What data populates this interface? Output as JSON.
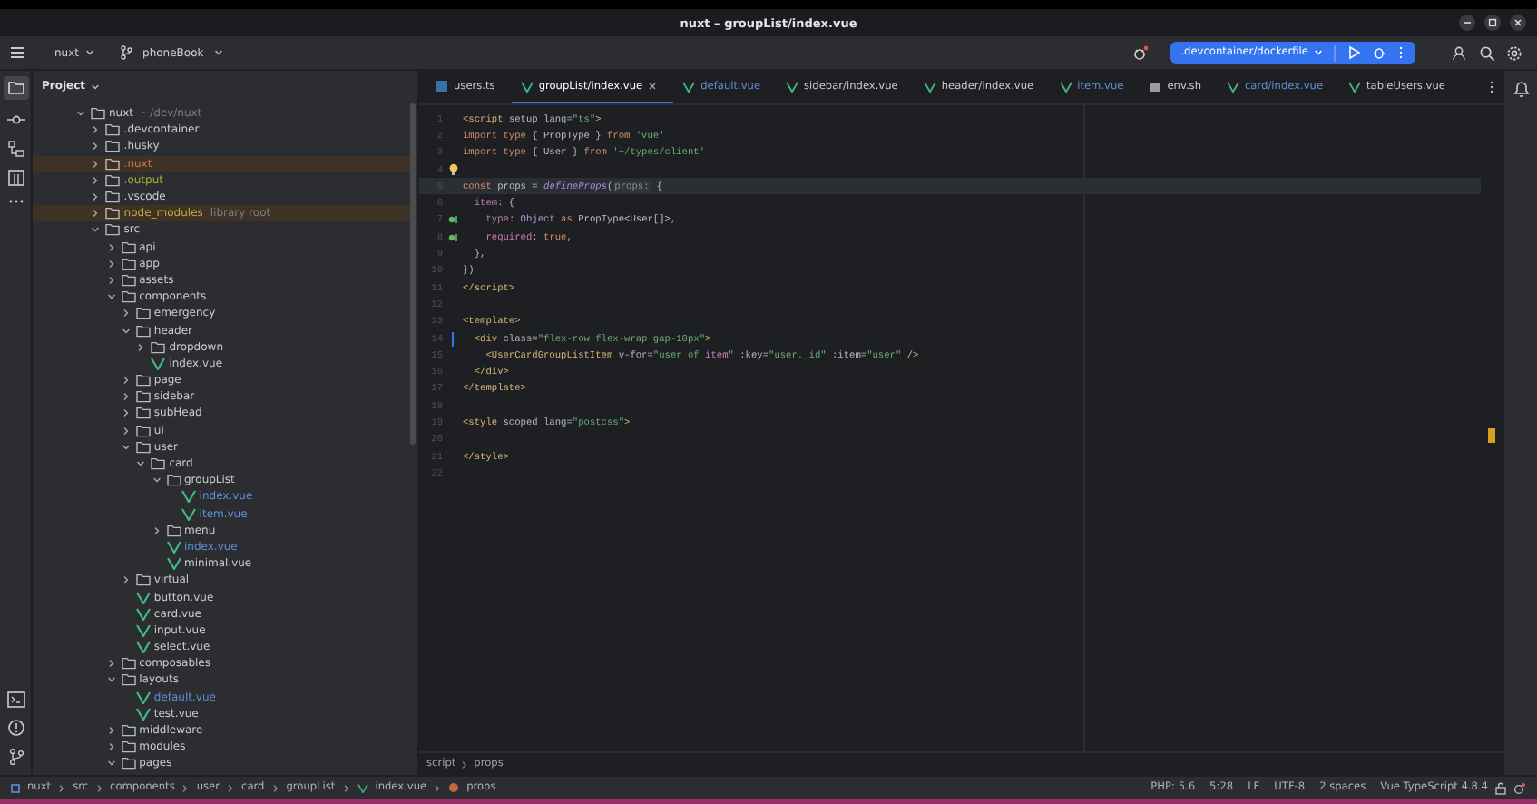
{
  "window": {
    "title": "nuxt – groupList/index.vue"
  },
  "toolbar": {
    "project": "nuxt",
    "branch": "phoneBook",
    "run_config": ".devcontainer/dockerfile"
  },
  "project_panel": {
    "title": "Project",
    "tree": [
      {
        "name": "nuxt",
        "hint": "~/dev/nuxt",
        "kind": "folder",
        "expanded": true,
        "excluded": false,
        "children": [
          {
            "name": ".devcontainer",
            "kind": "folder",
            "expanded": false,
            "excluded": false
          },
          {
            "name": ".husky",
            "kind": "folder",
            "expanded": false,
            "excluded": false
          },
          {
            "name": ".nuxt",
            "kind": "folder",
            "expanded": false,
            "excluded": true,
            "color": "#c2794d"
          },
          {
            "name": ".output",
            "kind": "folder",
            "expanded": false,
            "excluded": false,
            "color": "#a3b13a"
          },
          {
            "name": ".vscode",
            "kind": "folder",
            "expanded": false,
            "excluded": false
          },
          {
            "name": "node_modules",
            "hint": "library root",
            "kind": "folder",
            "expanded": false,
            "excluded": true,
            "color": "#c6a83e"
          },
          {
            "name": "src",
            "kind": "folder",
            "expanded": true,
            "excluded": false,
            "children": [
              {
                "name": "api",
                "kind": "folder",
                "expanded": false,
                "excluded": false
              },
              {
                "name": "app",
                "kind": "folder",
                "expanded": false,
                "excluded": false
              },
              {
                "name": "assets",
                "kind": "folder",
                "expanded": false,
                "excluded": false
              },
              {
                "name": "components",
                "kind": "folder",
                "expanded": true,
                "excluded": false,
                "children": [
                  {
                    "name": "emergency",
                    "kind": "folder",
                    "expanded": false,
                    "excluded": false
                  },
                  {
                    "name": "header",
                    "kind": "folder",
                    "expanded": true,
                    "excluded": false,
                    "children": [
                      {
                        "name": "dropdown",
                        "kind": "folder",
                        "expanded": false,
                        "excluded": false
                      },
                      {
                        "name": "index.vue",
                        "kind": "vue",
                        "excluded": false
                      }
                    ]
                  },
                  {
                    "name": "page",
                    "kind": "folder",
                    "expanded": false,
                    "excluded": false
                  },
                  {
                    "name": "sidebar",
                    "kind": "folder",
                    "expanded": false,
                    "excluded": false
                  },
                  {
                    "name": "subHead",
                    "kind": "folder",
                    "expanded": false,
                    "excluded": false
                  },
                  {
                    "name": "ui",
                    "kind": "folder",
                    "expanded": false,
                    "excluded": false
                  },
                  {
                    "name": "user",
                    "kind": "folder",
                    "expanded": true,
                    "excluded": false,
                    "children": [
                      {
                        "name": "card",
                        "kind": "folder",
                        "expanded": true,
                        "excluded": false,
                        "children": [
                          {
                            "name": "groupList",
                            "kind": "folder",
                            "expanded": true,
                            "excluded": false,
                            "children": [
                              {
                                "name": "index.vue",
                                "kind": "vue",
                                "excluded": false,
                                "color": "#5f8fd6"
                              },
                              {
                                "name": "item.vue",
                                "kind": "vue",
                                "excluded": false,
                                "color": "#5f8fd6"
                              }
                            ]
                          },
                          {
                            "name": "menu",
                            "kind": "folder",
                            "expanded": false,
                            "excluded": false
                          },
                          {
                            "name": "index.vue",
                            "kind": "vue",
                            "excluded": false,
                            "color": "#5f8fd6"
                          },
                          {
                            "name": "minimal.vue",
                            "kind": "vue",
                            "excluded": false
                          }
                        ]
                      }
                    ]
                  },
                  {
                    "name": "virtual",
                    "kind": "folder",
                    "expanded": false,
                    "excluded": false
                  },
                  {
                    "name": "button.vue",
                    "kind": "vue",
                    "excluded": false
                  },
                  {
                    "name": "card.vue",
                    "kind": "vue",
                    "excluded": false
                  },
                  {
                    "name": "input.vue",
                    "kind": "vue",
                    "excluded": false
                  },
                  {
                    "name": "select.vue",
                    "kind": "vue",
                    "excluded": false
                  }
                ]
              },
              {
                "name": "composables",
                "kind": "folder",
                "expanded": false,
                "excluded": false
              },
              {
                "name": "layouts",
                "kind": "folder",
                "expanded": true,
                "excluded": false,
                "children": [
                  {
                    "name": "default.vue",
                    "kind": "vue",
                    "excluded": false,
                    "color": "#5f8fd6"
                  },
                  {
                    "name": "test.vue",
                    "kind": "vue",
                    "excluded": false
                  }
                ]
              },
              {
                "name": "middleware",
                "kind": "folder",
                "expanded": false,
                "excluded": false
              },
              {
                "name": "modules",
                "kind": "folder",
                "expanded": false,
                "excluded": false
              },
              {
                "name": "pages",
                "kind": "folder",
                "expanded": true,
                "excluded": false
              }
            ]
          }
        ]
      }
    ]
  },
  "tabs": [
    {
      "label": "users.ts",
      "kind": "ts",
      "selected": false
    },
    {
      "label": "groupList/index.vue",
      "kind": "vue",
      "selected": true
    },
    {
      "label": "default.vue",
      "kind": "vue",
      "selected": false,
      "color": "#5f8fd6"
    },
    {
      "label": "sidebar/index.vue",
      "kind": "vue",
      "selected": false
    },
    {
      "label": "header/index.vue",
      "kind": "vue",
      "selected": false
    },
    {
      "label": "item.vue",
      "kind": "vue",
      "selected": false,
      "color": "#5f8fd6"
    },
    {
      "label": "env.sh",
      "kind": "sh",
      "selected": false
    },
    {
      "label": "card/index.vue",
      "kind": "vue",
      "selected": false,
      "color": "#5f8fd6"
    },
    {
      "label": "tableUsers.vue",
      "kind": "vue",
      "selected": false
    }
  ],
  "code": [
    {
      "no": "1",
      "current": false,
      "tokens": [
        {
          "kind": "tag",
          "text": "<script"
        },
        {
          "kind": "attr",
          "text": " setup lang="
        },
        {
          "kind": "string",
          "text": "\"ts\""
        },
        {
          "kind": "tag",
          "text": ">"
        }
      ]
    },
    {
      "no": "2",
      "current": false,
      "tokens": [
        {
          "kind": "keyword",
          "text": "import type"
        },
        {
          "kind": "plain",
          "text": " { PropType } "
        },
        {
          "kind": "keyword",
          "text": "from"
        },
        {
          "kind": "string",
          "text": " 'vue'"
        }
      ]
    },
    {
      "no": "3",
      "current": false,
      "tokens": [
        {
          "kind": "keyword",
          "text": "import type"
        },
        {
          "kind": "plain",
          "text": " { User } "
        },
        {
          "kind": "keyword",
          "text": "from"
        },
        {
          "kind": "string",
          "text": " '~/types/client'"
        }
      ]
    },
    {
      "no": "4",
      "current": false,
      "gutter": {
        "kind": "bulb"
      }
    },
    {
      "no": "5",
      "current": true,
      "tokens": [
        {
          "kind": "keyword",
          "text": "const"
        },
        {
          "kind": "plain",
          "text": " props = "
        },
        {
          "kind": "function",
          "text": "defineProps"
        },
        {
          "kind": "plain",
          "text": "("
        },
        {
          "kind": "hint",
          "text": "props:"
        },
        {
          "kind": "plain",
          "text": " {"
        }
      ]
    },
    {
      "no": "6",
      "current": false,
      "tokens": [
        {
          "kind": "member",
          "text": "  item"
        },
        {
          "kind": "plain",
          "text": ": {"
        }
      ]
    },
    {
      "no": "7",
      "current": false,
      "gutter": {
        "kind": "impl"
      },
      "tokens": [
        {
          "kind": "member",
          "text": "    type"
        },
        {
          "kind": "plain",
          "text": ": "
        },
        {
          "kind": "type",
          "text": "Object"
        },
        {
          "kind": "keyword",
          "text": " as"
        },
        {
          "kind": "plain",
          "text": " PropType<User[]>,"
        }
      ]
    },
    {
      "no": "8",
      "current": false,
      "gutter": {
        "kind": "impl"
      },
      "tokens": [
        {
          "kind": "member",
          "text": "    required"
        },
        {
          "kind": "plain",
          "text": ": "
        },
        {
          "kind": "keyword",
          "text": "true"
        },
        {
          "kind": "plain",
          "text": ","
        }
      ]
    },
    {
      "no": "9",
      "current": false,
      "tokens": [
        {
          "kind": "plain",
          "text": "  },"
        }
      ]
    },
    {
      "no": "10",
      "current": false,
      "tokens": [
        {
          "kind": "plain",
          "text": "})"
        }
      ]
    },
    {
      "no": "11",
      "current": false,
      "tokens": [
        {
          "kind": "tag",
          "text": "</script>"
        }
      ]
    },
    {
      "no": "12",
      "current": false
    },
    {
      "no": "13",
      "current": false,
      "tokens": [
        {
          "kind": "tag",
          "text": "<template>"
        }
      ]
    },
    {
      "no": "14",
      "current": false,
      "gutter": {
        "kind": "changed"
      },
      "tokens": [
        {
          "kind": "tag",
          "text": "  <div"
        },
        {
          "kind": "attr",
          "text": " class="
        },
        {
          "kind": "string",
          "text": "\"flex-row flex-wrap gap-10px\""
        },
        {
          "kind": "tag",
          "text": ">"
        }
      ]
    },
    {
      "no": "15",
      "current": false,
      "tokens": [
        {
          "kind": "tag",
          "text": "    <UserCardGroupListItem"
        },
        {
          "kind": "attr",
          "text": " v-for="
        },
        {
          "kind": "string",
          "text": "\"user of "
        },
        {
          "kind": "member",
          "text": "item"
        },
        {
          "kind": "string",
          "text": "\""
        },
        {
          "kind": "attr",
          "text": " :key="
        },
        {
          "kind": "string",
          "text": "\"user._id\""
        },
        {
          "kind": "attr",
          "text": " :item="
        },
        {
          "kind": "string",
          "text": "\"user\""
        },
        {
          "kind": "tag",
          "text": " />"
        }
      ]
    },
    {
      "no": "16",
      "current": false,
      "tokens": [
        {
          "kind": "tag",
          "text": "  </div>"
        }
      ]
    },
    {
      "no": "17",
      "current": false,
      "tokens": [
        {
          "kind": "tag",
          "text": "</template>"
        }
      ]
    },
    {
      "no": "18",
      "current": false
    },
    {
      "no": "19",
      "current": false,
      "tokens": [
        {
          "kind": "tag",
          "text": "<style"
        },
        {
          "kind": "attr",
          "text": " scoped lang="
        },
        {
          "kind": "string",
          "text": "\"postcss\""
        },
        {
          "kind": "tag",
          "text": ">"
        }
      ]
    },
    {
      "no": "20",
      "current": false
    },
    {
      "no": "21",
      "current": false,
      "tokens": [
        {
          "kind": "tag",
          "text": "</style>"
        }
      ]
    },
    {
      "no": "22",
      "current": false
    }
  ],
  "editor_breadcrumb": [
    "script",
    "props"
  ],
  "status_bar": {
    "path": [
      "nuxt",
      "src",
      "components",
      "user",
      "card",
      "groupList",
      "index.vue",
      "props"
    ],
    "items": [
      "PHP: 5.6",
      "5:28",
      "LF",
      "UTF-8",
      "2 spaces",
      "Vue TypeScript 4.8.4"
    ]
  }
}
